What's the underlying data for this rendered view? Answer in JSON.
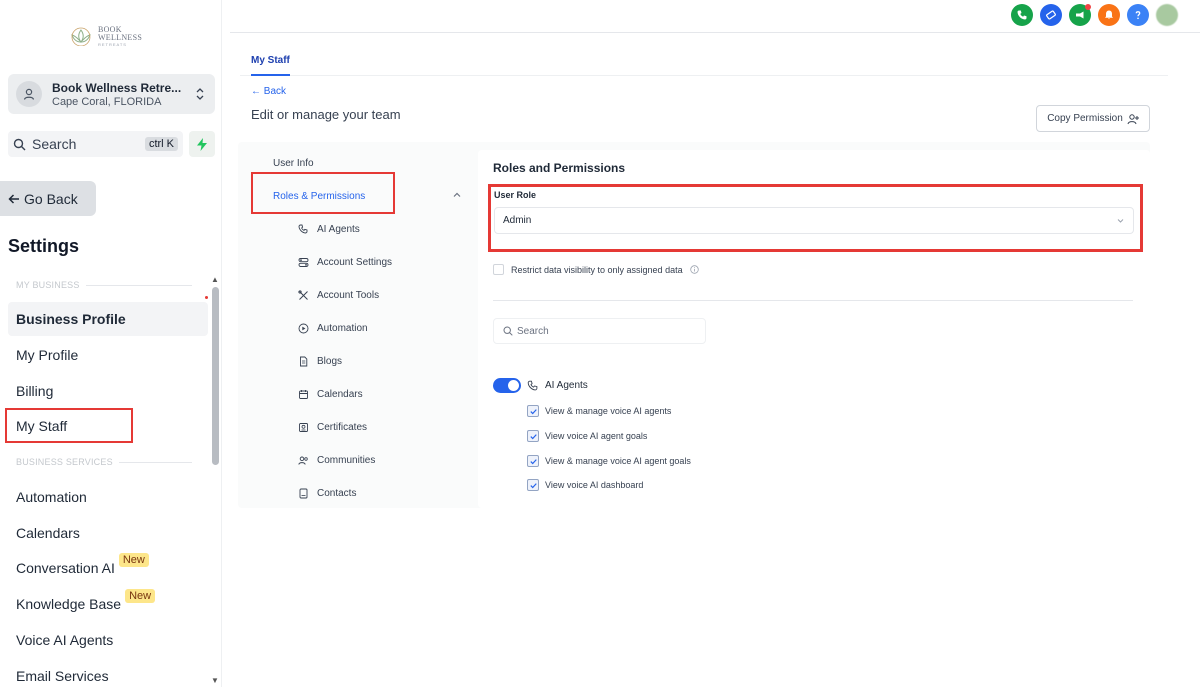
{
  "brand": {
    "logo_text": "BOOK WELLNESS",
    "logo_sub": "RETREATS"
  },
  "account": {
    "name": "Book Wellness Retre...",
    "location": "Cape Coral, FLORIDA"
  },
  "search": {
    "label": "Search",
    "shortcut": "ctrl K"
  },
  "go_back": "Go Back",
  "settings_title": "Settings",
  "sections": {
    "my_business": "MY BUSINESS",
    "business_services": "BUSINESS SERVICES"
  },
  "nav_my_business": [
    {
      "label": "Business Profile"
    },
    {
      "label": "My Profile"
    },
    {
      "label": "Billing"
    },
    {
      "label": "My Staff"
    }
  ],
  "nav_services": [
    {
      "label": "Automation",
      "badge": ""
    },
    {
      "label": "Calendars",
      "badge": ""
    },
    {
      "label": "Conversation AI",
      "badge": "New"
    },
    {
      "label": "Knowledge Base",
      "badge": "New"
    },
    {
      "label": "Voice AI Agents",
      "badge": ""
    },
    {
      "label": "Email Services",
      "badge": ""
    }
  ],
  "top_icons": [
    {
      "name": "phone-icon",
      "color": "#16a34a"
    },
    {
      "name": "ticket-icon",
      "color": "#2563eb"
    },
    {
      "name": "megaphone-icon",
      "color": "#16a34a"
    },
    {
      "name": "bell-icon",
      "color": "#f97316"
    },
    {
      "name": "help-icon",
      "color": "#3b82f6"
    }
  ],
  "tab": "My Staff",
  "back": "Back",
  "subtitle": "Edit or manage your team",
  "copy_permission": "Copy Permission",
  "sub_nav": {
    "user_info": "User Info",
    "roles_permissions": "Roles & Permissions",
    "items": [
      "AI Agents",
      "Account Settings",
      "Account Tools",
      "Automation",
      "Blogs",
      "Calendars",
      "Certificates",
      "Communities",
      "Contacts"
    ]
  },
  "roles": {
    "heading": "Roles and Permissions",
    "user_role_label": "User Role",
    "user_role_value": "Admin",
    "restrict_label": "Restrict data visibility to only assigned data",
    "search_placeholder": "Search",
    "group_name": "AI Agents",
    "permissions": [
      "View & manage voice AI agents",
      "View voice AI agent goals",
      "View & manage voice AI agent goals",
      "View voice AI dashboard"
    ]
  }
}
